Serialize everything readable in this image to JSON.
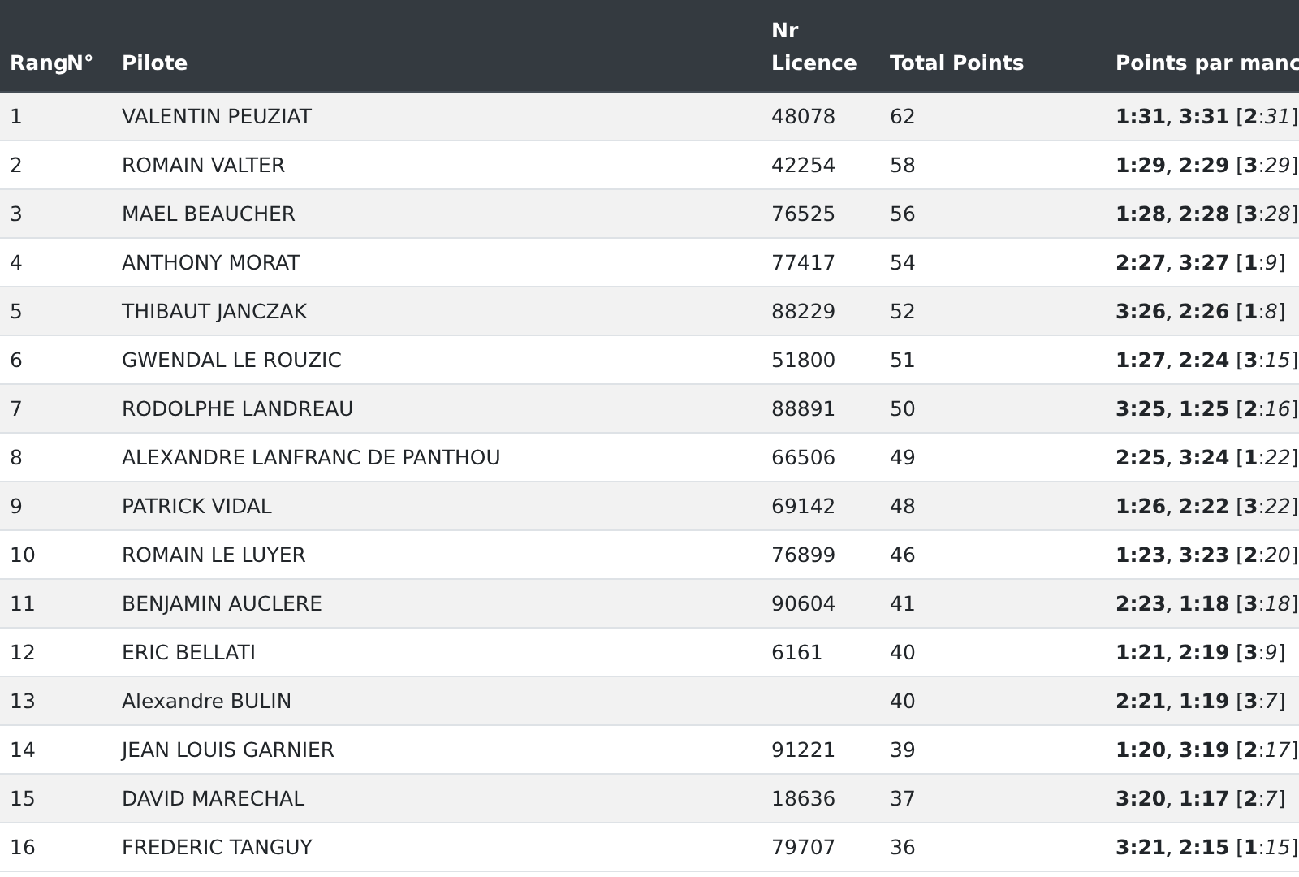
{
  "table": {
    "columns": [
      "Rang",
      "N°",
      "Pilote",
      "Nr Licence",
      "Total Points",
      "Points par manc"
    ],
    "rows": [
      {
        "rank": "1",
        "pilot": "VALENTIN PEUZIAT",
        "licence": "48078",
        "total": "62",
        "points": "**1:31**, **3:31** [**2**:*31*]"
      },
      {
        "rank": "2",
        "pilot": "ROMAIN VALTER",
        "licence": "42254",
        "total": "58",
        "points": "**1:29**, **2:29** [**3**:*29*]"
      },
      {
        "rank": "3",
        "pilot": "MAEL BEAUCHER",
        "licence": "76525",
        "total": "56",
        "points": "**1:28**, **2:28** [**3**:*28*]"
      },
      {
        "rank": "4",
        "pilot": "ANTHONY MORAT",
        "licence": "77417",
        "total": "54",
        "points": "**2:27**, **3:27** [**1**:*9*]"
      },
      {
        "rank": "5",
        "pilot": "THIBAUT JANCZAK",
        "licence": "88229",
        "total": "52",
        "points": "**3:26**, **2:26** [**1**:*8*]"
      },
      {
        "rank": "6",
        "pilot": "GWENDAL LE ROUZIC",
        "licence": "51800",
        "total": "51",
        "points": "**1:27**, **2:24** [**3**:*15*]"
      },
      {
        "rank": "7",
        "pilot": "RODOLPHE LANDREAU",
        "licence": "88891",
        "total": "50",
        "points": "**3:25**, **1:25** [**2**:*16*]"
      },
      {
        "rank": "8",
        "pilot": "ALEXANDRE LANFRANC DE PANTHOU",
        "licence": "66506",
        "total": "49",
        "points": "**2:25**, **3:24** [**1**:*22*]"
      },
      {
        "rank": "9",
        "pilot": "PATRICK VIDAL",
        "licence": "69142",
        "total": "48",
        "points": "**1:26**, **2:22** [**3**:*22*]"
      },
      {
        "rank": "10",
        "pilot": "ROMAIN LE LUYER",
        "licence": "76899",
        "total": "46",
        "points": "**1:23**, **3:23** [**2**:*20*]"
      },
      {
        "rank": "11",
        "pilot": "BENJAMIN AUCLERE",
        "licence": "90604",
        "total": "41",
        "points": "**2:23**, **1:18** [**3**:*18*]"
      },
      {
        "rank": "12",
        "pilot": "ERIC BELLATI",
        "licence": "6161",
        "total": "40",
        "points": "**1:21**, **2:19** [**3**:*9*]"
      },
      {
        "rank": "13",
        "pilot": "Alexandre BULIN",
        "total": "40",
        "points": "**2:21**, **1:19** [**3**:*7*]"
      },
      {
        "rank": "14",
        "pilot": "JEAN LOUIS GARNIER",
        "licence": "91221",
        "total": "39",
        "points": "**1:20**, **3:19** [**2**:*17*]"
      },
      {
        "rank": "15",
        "pilot": "DAVID MARECHAL",
        "licence": "18636",
        "total": "37",
        "points": "**3:20**, **1:17** [**2**:*7*]"
      },
      {
        "rank": "16",
        "pilot": "FREDERIC TANGUY",
        "licence": "79707",
        "total": "36",
        "points": "**3:21**, **2:15** [**1**:*15*]"
      }
    ]
  }
}
